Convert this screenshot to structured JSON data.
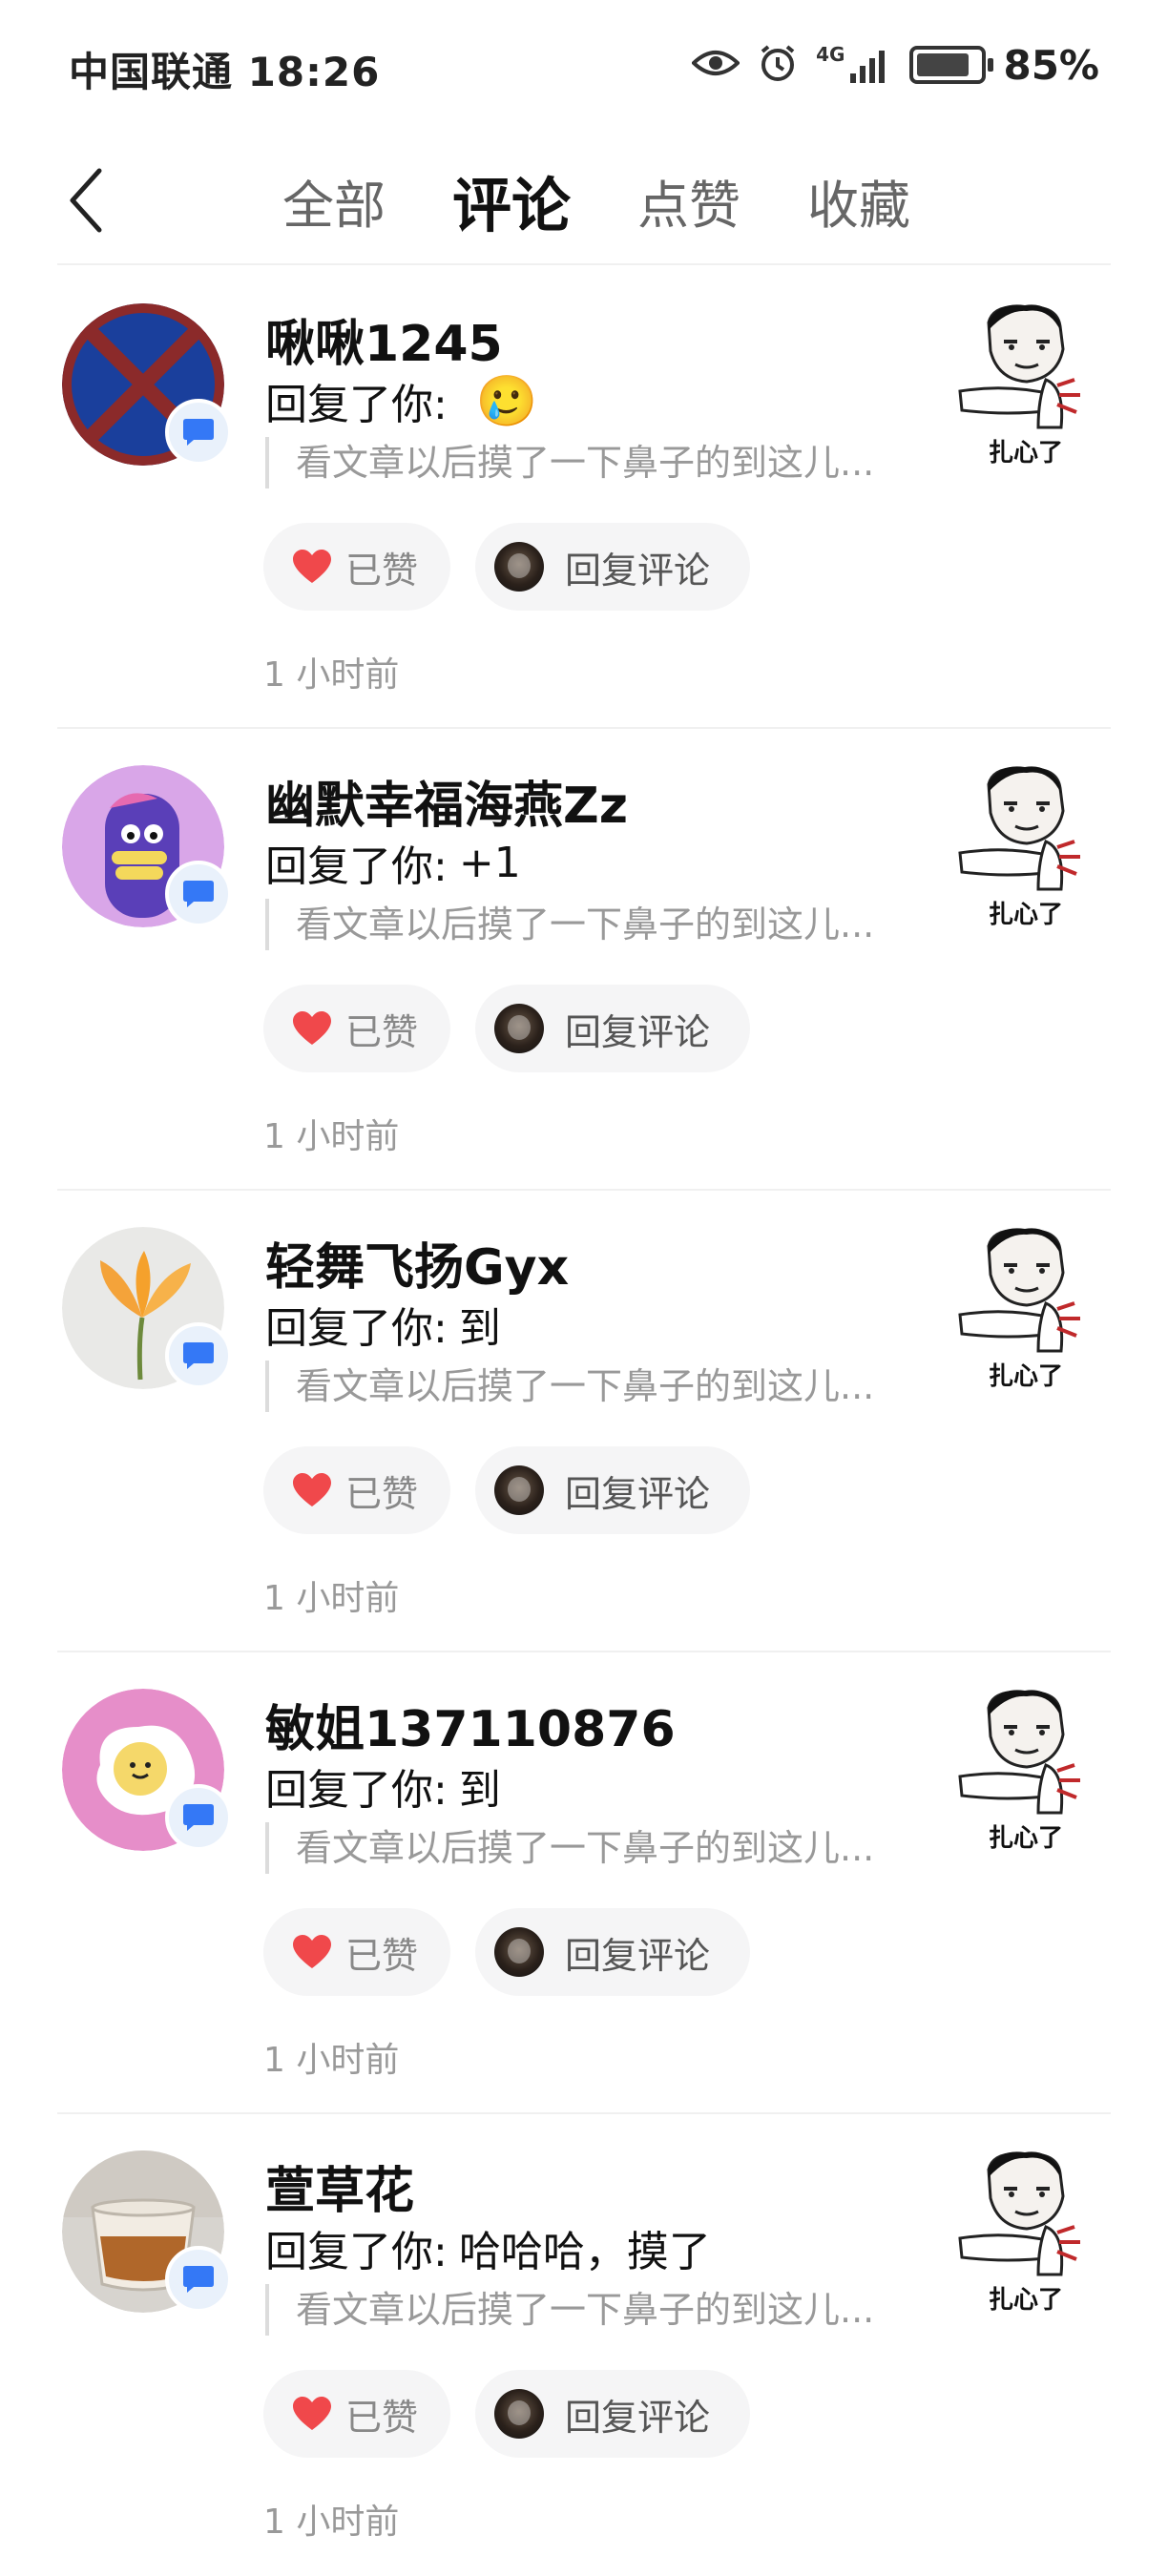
{
  "status_bar": {
    "carrier_time": "中国联通 18:26",
    "network": "4G",
    "battery": "85%",
    "battery_level": 0.85
  },
  "header": {
    "tabs": [
      {
        "label": "全部",
        "active": false
      },
      {
        "label": "评论",
        "active": true
      },
      {
        "label": "点赞",
        "active": false
      },
      {
        "label": "收藏",
        "active": false
      }
    ]
  },
  "notifications": [
    {
      "username": "啾啾1245",
      "reply_prefix": "回复了你:",
      "reply_text": "",
      "emoji": "🥲",
      "quote": "看文章以后摸了一下鼻子的到这儿...",
      "liked_label": "已赞",
      "reply_button_label": "回复评论",
      "time": "1 小时前",
      "thumb_caption": "扎心了",
      "avatar": "avatar-blue-x"
    },
    {
      "username": "幽默幸福海燕Zz",
      "reply_prefix": "回复了你:",
      "reply_text": "+1",
      "emoji": "",
      "quote": "看文章以后摸了一下鼻子的到这儿...",
      "liked_label": "已赞",
      "reply_button_label": "回复评论",
      "time": "1 小时前",
      "thumb_caption": "扎心了",
      "avatar": "avatar-purple-monster"
    },
    {
      "username": "轻舞飞扬Gyx",
      "reply_prefix": "回复了你:",
      "reply_text": "到",
      "emoji": "",
      "quote": "看文章以后摸了一下鼻子的到这儿...",
      "liked_label": "已赞",
      "reply_button_label": "回复评论",
      "time": "1 小时前",
      "thumb_caption": "扎心了",
      "avatar": "avatar-flower"
    },
    {
      "username": "敏姐137110876",
      "reply_prefix": "回复了你:",
      "reply_text": "到",
      "emoji": "",
      "quote": "看文章以后摸了一下鼻子的到这儿...",
      "liked_label": "已赞",
      "reply_button_label": "回复评论",
      "time": "1 小时前",
      "thumb_caption": "扎心了",
      "avatar": "avatar-egg"
    },
    {
      "username": "萱草花",
      "reply_prefix": "回复了你:",
      "reply_text": "哈哈哈，摸了",
      "emoji": "",
      "quote": "看文章以后摸了一下鼻子的到这儿...",
      "liked_label": "已赞",
      "reply_button_label": "回复评论",
      "time": "1 小时前",
      "thumb_caption": "扎心了",
      "avatar": "avatar-tea"
    }
  ],
  "colors": {
    "like_heart": "#f0484b",
    "badge_blue": "#3478f6",
    "muted_text": "#999999"
  }
}
